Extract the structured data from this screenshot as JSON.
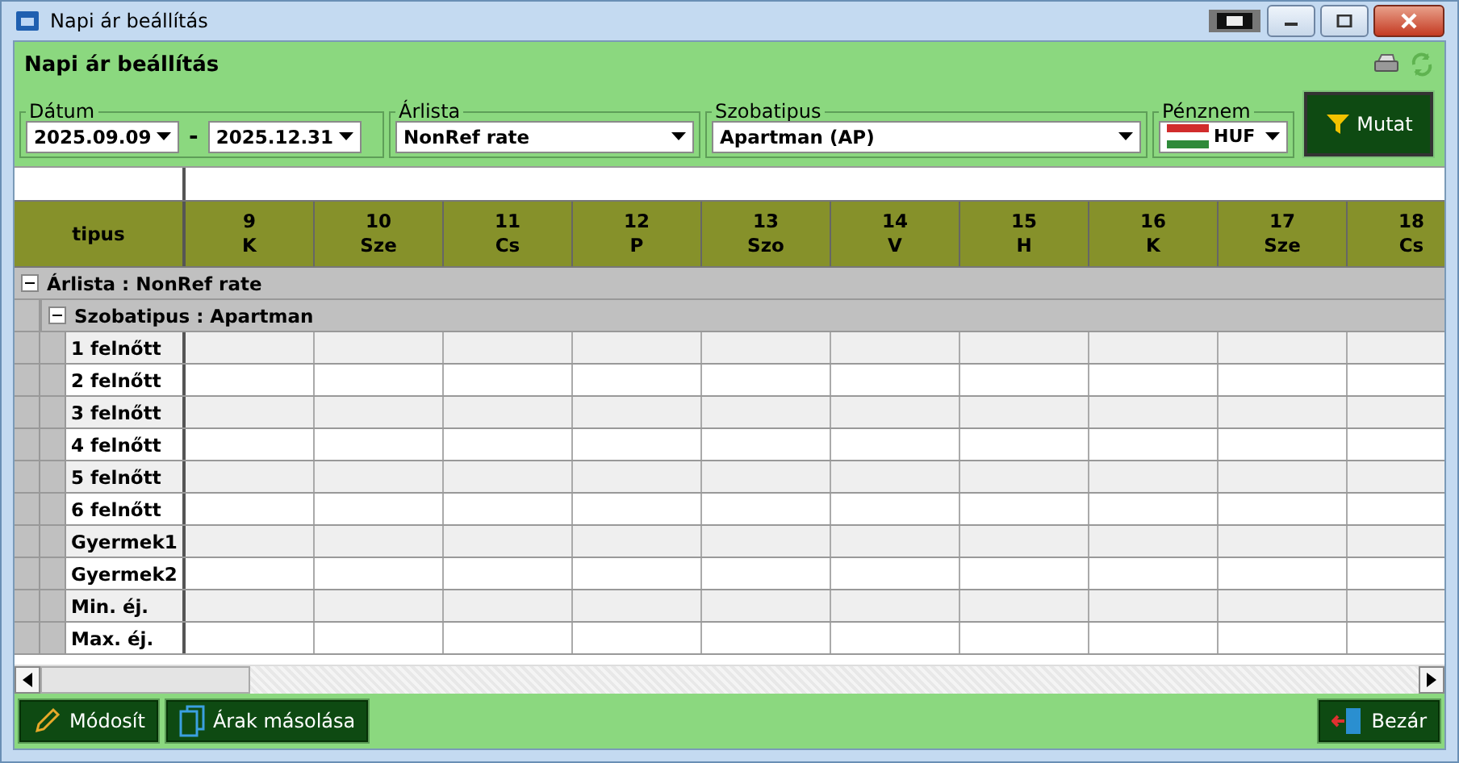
{
  "window": {
    "title": "Napi ár beállítás"
  },
  "panel": {
    "title": "Napi ár beállítás"
  },
  "filters": {
    "date": {
      "label": "Dátum",
      "from": "2025.09.09",
      "separator": "-",
      "to": "2025.12.31"
    },
    "price_list": {
      "label": "Árlista",
      "value": "NonRef rate"
    },
    "room_type": {
      "label": "Szobatipus",
      "value": "Apartman (AP)"
    },
    "currency": {
      "label": "Pénznem",
      "value": "HUF"
    },
    "show_button": "Mutat"
  },
  "grid": {
    "type_header": "tipus",
    "days": [
      {
        "day": "9",
        "weekday": "K"
      },
      {
        "day": "10",
        "weekday": "Sze"
      },
      {
        "day": "11",
        "weekday": "Cs"
      },
      {
        "day": "12",
        "weekday": "P"
      },
      {
        "day": "13",
        "weekday": "Szo"
      },
      {
        "day": "14",
        "weekday": "V"
      },
      {
        "day": "15",
        "weekday": "H"
      },
      {
        "day": "16",
        "weekday": "K"
      },
      {
        "day": "17",
        "weekday": "Sze"
      },
      {
        "day": "18",
        "weekday": "Cs"
      }
    ],
    "group": {
      "label": "Árlista : NonRef rate",
      "expanded": true,
      "subgroup": {
        "label": "Szobatipus : Apartman",
        "expanded": true,
        "rows": [
          "1 felnőtt",
          "2 felnőtt",
          "3 felnőtt",
          "4 felnőtt",
          "5 felnőtt",
          "6 felnőtt",
          "Gyermek1",
          "Gyermek2",
          "Min. éj.",
          "Max. éj."
        ]
      }
    }
  },
  "buttons": {
    "left": [
      "Módosít",
      "Árak másolása"
    ],
    "right": "Bezár"
  }
}
